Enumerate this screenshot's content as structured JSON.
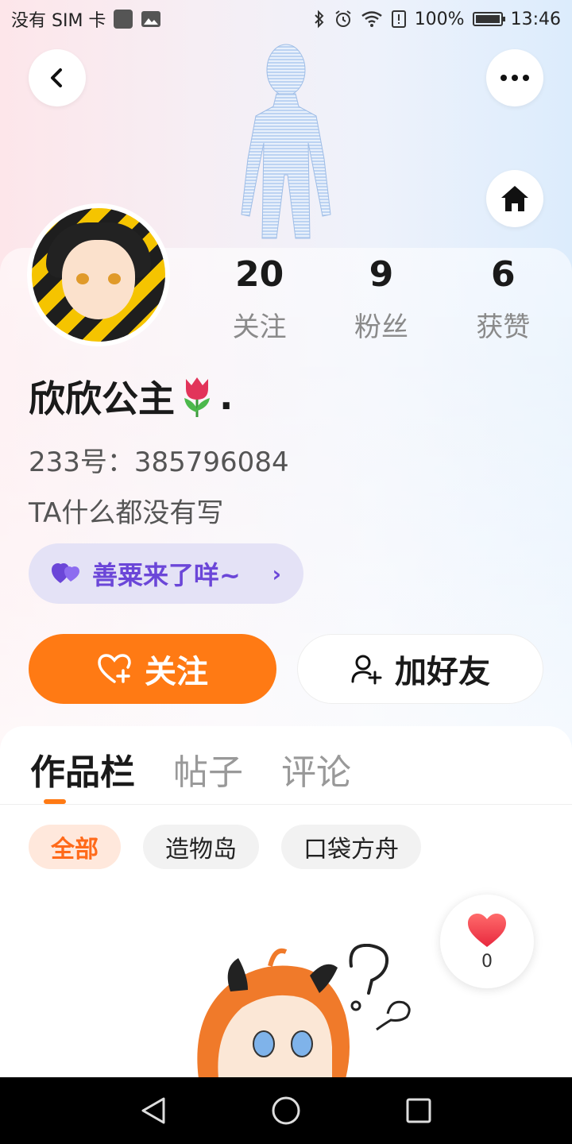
{
  "status_bar": {
    "carrier": "没有 SIM 卡",
    "battery": "100%",
    "time": "13:46",
    "icons": [
      "sim-square-icon",
      "image-icon",
      "bluetooth-icon",
      "alarm-icon",
      "wifi-icon",
      "storage-alert-icon",
      "battery-icon"
    ]
  },
  "header": {
    "back_icon": "chevron-left-icon",
    "more_icon": "more-dots-icon",
    "home_icon": "home-icon"
  },
  "profile": {
    "name": "欣欣公主",
    "name_suffix": ".",
    "name_emoji": "tulip-icon",
    "uid": "233号：385796084",
    "bio": "TA什么都没有写",
    "stats": [
      {
        "value": "20",
        "label": "关注"
      },
      {
        "value": "9",
        "label": "粉丝"
      },
      {
        "value": "6",
        "label": "获赞"
      }
    ],
    "badge": {
      "label": "善粟来了咩~",
      "icon": "purple-hearts-icon",
      "chevron": "›"
    }
  },
  "actions": {
    "follow_label": "关注",
    "add_friend_label": "加好友"
  },
  "tabs": [
    {
      "label": "作品栏",
      "active": true
    },
    {
      "label": "帖子",
      "active": false
    },
    {
      "label": "评论",
      "active": false
    }
  ],
  "filters": [
    {
      "label": "全部",
      "active": true
    },
    {
      "label": "造物岛",
      "active": false
    },
    {
      "label": "口袋方舟",
      "active": false
    }
  ],
  "like_fab": {
    "count": "0"
  },
  "colors": {
    "accent": "#ff7a14",
    "badge_bg": "#e4e2f6",
    "badge_text": "#6b46d8",
    "chip_active_bg": "#ffe8dc"
  }
}
